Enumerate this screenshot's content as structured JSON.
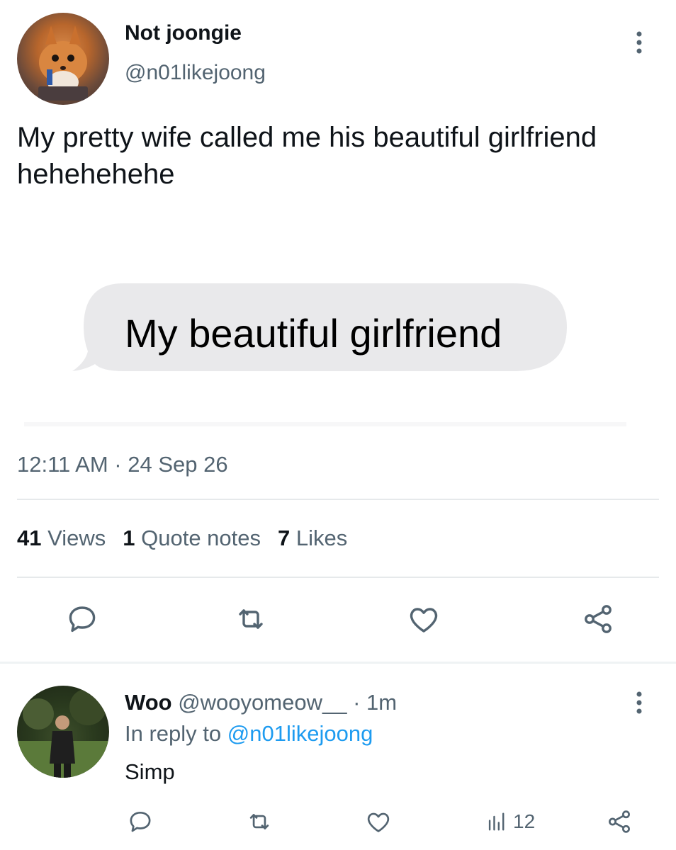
{
  "tweet": {
    "display_name": "Not joongie",
    "handle": "@n01likejoong",
    "text": "My pretty wife called me his beautiful girlfriend hehehehehe",
    "media_bubble_text": "My beautiful girlfriend",
    "timestamp": "12:11 AM · 24 Sep 26",
    "stats": {
      "views_count": "41",
      "views_label": "Views",
      "quotes_count": "1",
      "quotes_label": "Quote notes",
      "likes_count": "7",
      "likes_label": "Likes"
    },
    "actions": [
      "reply-icon",
      "retweet-icon",
      "like-icon",
      "share-icon"
    ]
  },
  "reply": {
    "display_name": "Woo",
    "handle": "@wooyomeow__",
    "time": "· 1m",
    "in_reply_prefix": "In reply to",
    "in_reply_handle": "@n01likejoong",
    "text": "Simp",
    "views": "12",
    "actions": [
      "reply-icon",
      "retweet-icon",
      "like-icon",
      "views-icon",
      "share-icon"
    ]
  },
  "colors": {
    "text": "#0f1419",
    "secondary": "#536471",
    "link": "#1d9bf0",
    "bubble": "#e9e9eb"
  }
}
